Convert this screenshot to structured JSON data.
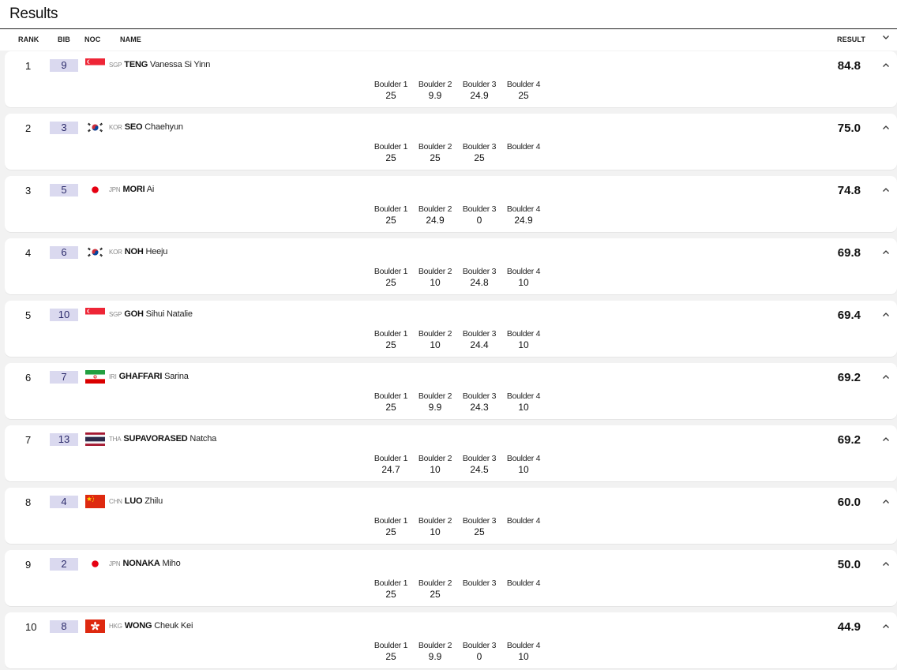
{
  "title": "Results",
  "columns": {
    "rank": "RANK",
    "bib": "BIB",
    "noc": "NOC",
    "name": "NAME",
    "result": "RESULT"
  },
  "boulder_labels": [
    "Boulder 1",
    "Boulder 2",
    "Boulder 3",
    "Boulder 4"
  ],
  "rows": [
    {
      "rank": "1",
      "bib": "9",
      "noc": "SGP",
      "flag": "sgp",
      "last": "TENG",
      "first": "Vanessa Si Yinn",
      "result": "84.8",
      "scores": [
        "25",
        "9.9",
        "24.9",
        "25"
      ]
    },
    {
      "rank": "2",
      "bib": "3",
      "noc": "KOR",
      "flag": "kor",
      "last": "SEO",
      "first": "Chaehyun",
      "result": "75.0",
      "scores": [
        "25",
        "25",
        "25",
        ""
      ]
    },
    {
      "rank": "3",
      "bib": "5",
      "noc": "JPN",
      "flag": "jpn",
      "last": "MORI",
      "first": "Ai",
      "result": "74.8",
      "scores": [
        "25",
        "24.9",
        "0",
        "24.9"
      ]
    },
    {
      "rank": "4",
      "bib": "6",
      "noc": "KOR",
      "flag": "kor",
      "last": "NOH",
      "first": "Heeju",
      "result": "69.8",
      "scores": [
        "25",
        "10",
        "24.8",
        "10"
      ]
    },
    {
      "rank": "5",
      "bib": "10",
      "noc": "SGP",
      "flag": "sgp",
      "last": "GOH",
      "first": "Sihui Natalie",
      "result": "69.4",
      "scores": [
        "25",
        "10",
        "24.4",
        "10"
      ]
    },
    {
      "rank": "6",
      "bib": "7",
      "noc": "IRI",
      "flag": "iri",
      "last": "GHAFFARI",
      "first": "Sarina",
      "result": "69.2",
      "scores": [
        "25",
        "9.9",
        "24.3",
        "10"
      ]
    },
    {
      "rank": "7",
      "bib": "13",
      "noc": "THA",
      "flag": "tha",
      "last": "SUPAVORASED",
      "first": "Natcha",
      "result": "69.2",
      "scores": [
        "24.7",
        "10",
        "24.5",
        "10"
      ]
    },
    {
      "rank": "8",
      "bib": "4",
      "noc": "CHN",
      "flag": "chn",
      "last": "LUO",
      "first": "Zhilu",
      "result": "60.0",
      "scores": [
        "25",
        "10",
        "25",
        ""
      ]
    },
    {
      "rank": "9",
      "bib": "2",
      "noc": "JPN",
      "flag": "jpn",
      "last": "NONAKA",
      "first": "Miho",
      "result": "50.0",
      "scores": [
        "25",
        "25",
        "",
        ""
      ]
    },
    {
      "rank": "10",
      "bib": "8",
      "noc": "HKG",
      "flag": "hkg",
      "last": "WONG",
      "first": "Cheuk Kei",
      "result": "44.9",
      "scores": [
        "25",
        "9.9",
        "0",
        "10"
      ]
    }
  ]
}
